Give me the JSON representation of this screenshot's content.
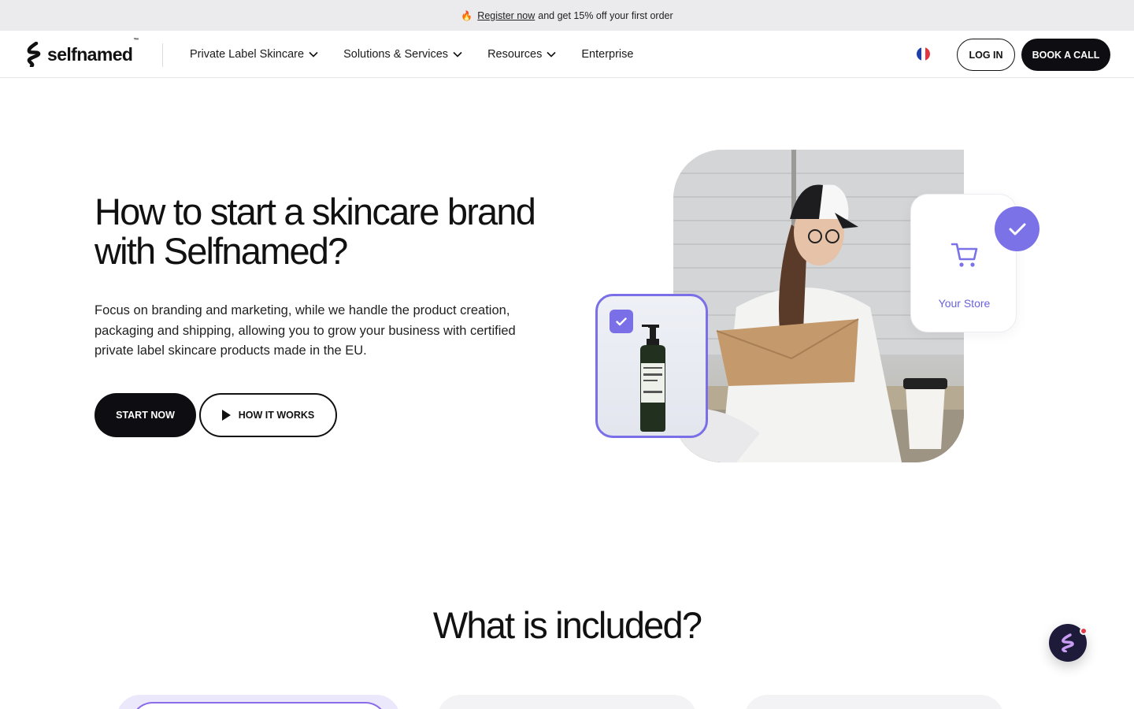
{
  "announcement": {
    "icon": "fire-icon",
    "link": "Register now",
    "text": "and get 15% off your first order"
  },
  "header": {
    "logo": "selfnamed",
    "logo_mark": "™",
    "nav": [
      {
        "label": "Private Label Skincare",
        "dropdown": true
      },
      {
        "label": "Solutions & Services",
        "dropdown": true
      },
      {
        "label": "Resources",
        "dropdown": true
      },
      {
        "label": "Enterprise",
        "dropdown": false
      }
    ],
    "language_flag": "french-flag-icon",
    "login": "LOG IN",
    "book": "BOOK A CALL"
  },
  "hero": {
    "title": "How to start a skincare brand with Selfnamed?",
    "description": "Focus on branding and marketing, while we handle the product creation, packaging and shipping, allowing you to grow your business with certified private label skincare products made in the EU.",
    "start": "START NOW",
    "how": "HOW IT WORKS",
    "store_label": "Your Store"
  },
  "section": {
    "title": "What is included?"
  },
  "colors": {
    "accent": "#7a72e6",
    "dark": "#0e0e12",
    "announce_bg": "#ebebed"
  }
}
